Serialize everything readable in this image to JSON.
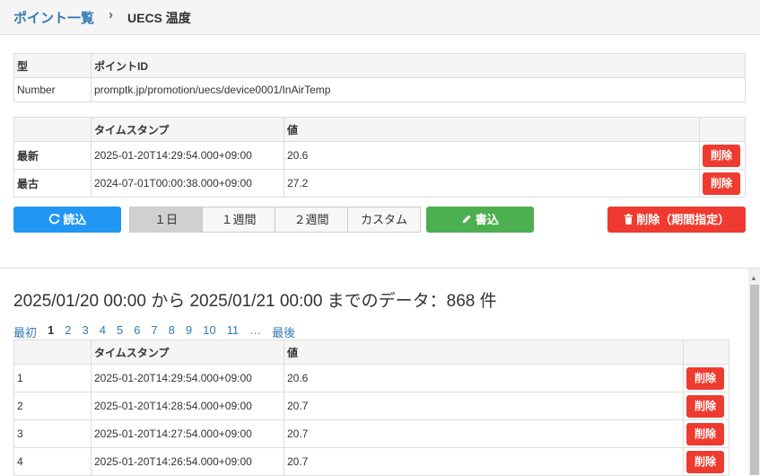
{
  "breadcrumb": {
    "link": "ポイント一覧",
    "sep": "›",
    "current": "UECS 温度"
  },
  "info_table": {
    "headers": [
      "型",
      "ポイントID"
    ],
    "row": [
      "Number",
      "promptk.jp/promotion/uecs/device0001/InAirTemp"
    ]
  },
  "latest_table": {
    "headers": [
      "",
      "タイムスタンプ",
      "値",
      ""
    ],
    "rows": [
      {
        "label": "最新",
        "timestamp": "2025-01-20T14:29:54.000+09:00",
        "value": "20.6",
        "action": "削除"
      },
      {
        "label": "最古",
        "timestamp": "2024-07-01T00:00:38.000+09:00",
        "value": "27.2",
        "action": "削除"
      }
    ]
  },
  "toolbar": {
    "read_icon": "refresh-icon",
    "read_label": "読込",
    "ranges": [
      "１日",
      "１週間",
      "２週間",
      "カスタム"
    ],
    "active_range": "１日",
    "write_icon": "pencil-icon",
    "write_label": "書込",
    "delete_icon": "trash-icon",
    "delete_range_label": "削除（期間指定）"
  },
  "summary": "2025/01/20 00:00 から 2025/01/21 00:00 までのデータ：868 件",
  "pagination": {
    "first": "最初",
    "pages": [
      "1",
      "2",
      "3",
      "4",
      "5",
      "6",
      "7",
      "8",
      "9",
      "10",
      "11"
    ],
    "current": "1",
    "ellipsis": "…",
    "last": "最後"
  },
  "data_table": {
    "headers": [
      "",
      "タイムスタンプ",
      "値",
      ""
    ],
    "rows": [
      {
        "index": "1",
        "timestamp": "2025-01-20T14:29:54.000+09:00",
        "value": "20.6",
        "action": "削除"
      },
      {
        "index": "2",
        "timestamp": "2025-01-20T14:28:54.000+09:00",
        "value": "20.7",
        "action": "削除"
      },
      {
        "index": "3",
        "timestamp": "2025-01-20T14:27:54.000+09:00",
        "value": "20.7",
        "action": "削除"
      },
      {
        "index": "4",
        "timestamp": "2025-01-20T14:26:54.000+09:00",
        "value": "20.7",
        "action": "削除"
      }
    ]
  },
  "colors": {
    "link": "#337ab7",
    "primary": "#2196f3",
    "success": "#4caf50",
    "danger": "#ef3b2f"
  }
}
